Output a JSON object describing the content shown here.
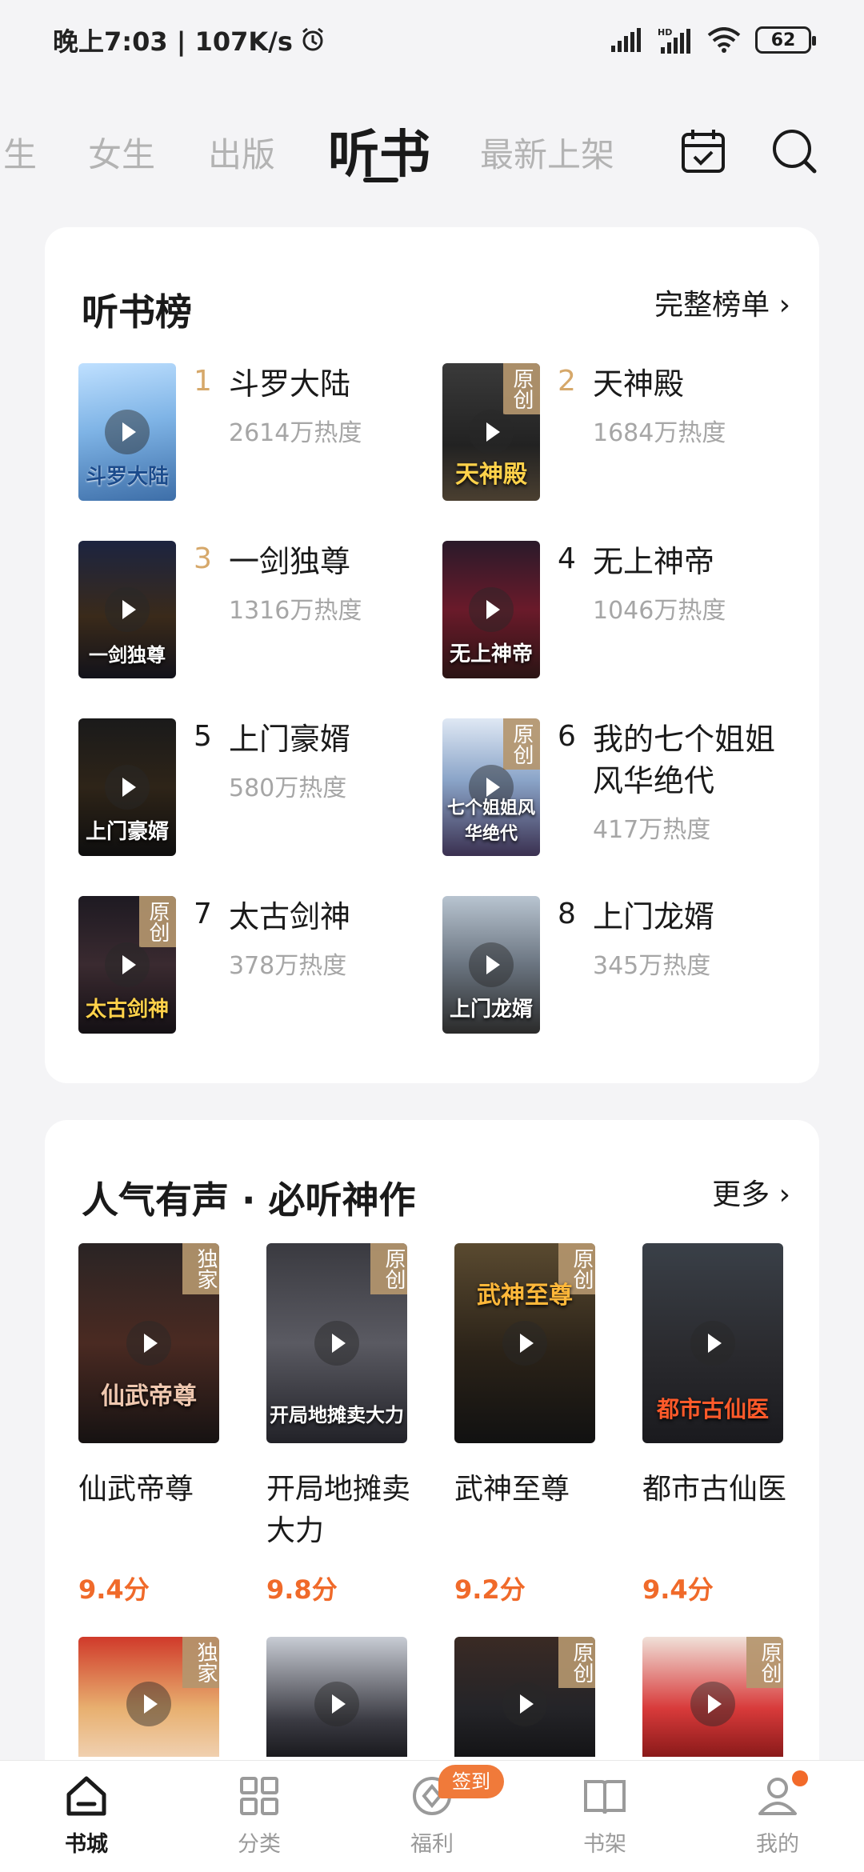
{
  "status_bar": {
    "time_speed": "晚上7:03 | 107K/s",
    "battery": "62"
  },
  "top_tabs": {
    "items": [
      "生",
      "女生",
      "出版",
      "听书",
      "最新上架"
    ],
    "active": "听书"
  },
  "ranking": {
    "title": "听书榜",
    "more_label": "完整榜单 ›",
    "items": [
      {
        "rank": "1",
        "name": "斗罗大陆",
        "heat": "2614万热度",
        "tag": "",
        "cover_text": "斗罗大陆"
      },
      {
        "rank": "2",
        "name": "天神殿",
        "heat": "1684万热度",
        "tag": "原创",
        "cover_text": "天神殿"
      },
      {
        "rank": "3",
        "name": "一剑独尊",
        "heat": "1316万热度",
        "tag": "",
        "cover_text": "一剑独尊"
      },
      {
        "rank": "4",
        "name": "无上神帝",
        "heat": "1046万热度",
        "tag": "",
        "cover_text": "无上神帝"
      },
      {
        "rank": "5",
        "name": "上门豪婿",
        "heat": "580万热度",
        "tag": "",
        "cover_text": "上门豪婿"
      },
      {
        "rank": "6",
        "name": "我的七个姐姐风华绝代",
        "heat": "417万热度",
        "tag": "原创",
        "cover_text": "七个姐姐风华绝代"
      },
      {
        "rank": "7",
        "name": "太古剑神",
        "heat": "378万热度",
        "tag": "原创",
        "cover_text": "太古剑神"
      },
      {
        "rank": "8",
        "name": "上门龙婿",
        "heat": "345万热度",
        "tag": "",
        "cover_text": "上门龙婿"
      }
    ]
  },
  "popular": {
    "title": "人气有声 · 必听神作",
    "more_label": "更多 ›",
    "items": [
      {
        "name": "仙武帝尊",
        "score": "9.4分",
        "tag": "独家",
        "cover_text": "仙武帝尊"
      },
      {
        "name": "开局地摊卖大力",
        "score": "9.8分",
        "tag": "原创",
        "cover_text": "开局地摊卖大力"
      },
      {
        "name": "武神至尊",
        "score": "9.2分",
        "tag": "原创",
        "cover_text": "武神至尊"
      },
      {
        "name": "都市古仙医",
        "score": "9.4分",
        "tag": "",
        "cover_text": "都市古仙医"
      }
    ],
    "second_row_tags": [
      "独家",
      "",
      "原创",
      "原创"
    ]
  },
  "bottom_nav": {
    "items": [
      {
        "label": "书城",
        "icon": "home-icon"
      },
      {
        "label": "分类",
        "icon": "grid-icon"
      },
      {
        "label": "福利",
        "icon": "coin-icon"
      },
      {
        "label": "书架",
        "icon": "book-icon"
      },
      {
        "label": "我的",
        "icon": "user-icon"
      }
    ],
    "active": "书城",
    "sign_badge": "签到"
  }
}
